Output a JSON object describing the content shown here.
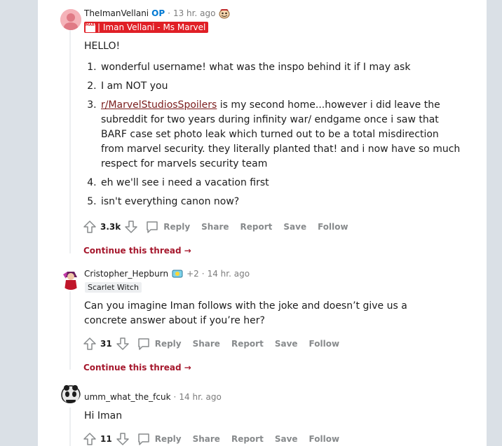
{
  "comments": [
    {
      "author": "TheImanVellani",
      "op_badge": "OP",
      "separator": "·",
      "time": "13 hr. ago",
      "flair": "| Iman Vellani - Ms Marvel",
      "flair_logo_text": "MARVEL STUDIOS",
      "greeting": "HELLO!",
      "list": [
        "wonderful username! what was the inspo behind it if I may ask",
        "I am NOT you",
        "is my second home...however i did leave the subreddit for two years during infinity war/ endgame once i saw that BARF case set photo leak which turned out to be a total misdirection from marvel security. they literally planted that! and i now have so much respect for marvels security team",
        "eh we'll see i need a vacation first",
        "isn't everything canon now?"
      ],
      "list_link": "r/MarvelStudiosSpoilers",
      "votes": "3.3k",
      "actions": {
        "reply": "Reply",
        "share": "Share",
        "report": "Report",
        "save": "Save",
        "follow": "Follow"
      },
      "continue": "Continue this thread →"
    },
    {
      "author": "Cristopher_Hepburn",
      "award_count": "+2",
      "separator": "·",
      "time": "14 hr. ago",
      "flair": "Scarlet Witch",
      "text": "Can you imagine Iman follows with the joke and doesn’t give us a concrete answer about if you’re her?",
      "votes": "31",
      "actions": {
        "reply": "Reply",
        "share": "Share",
        "report": "Report",
        "save": "Save",
        "follow": "Follow"
      },
      "continue": "Continue this thread →"
    },
    {
      "author": "umm_what_the_fcuk",
      "separator": "·",
      "time": "14 hr. ago",
      "text": "Hi Iman",
      "votes": "11",
      "actions": {
        "reply": "Reply",
        "share": "Share",
        "report": "Report",
        "save": "Save",
        "follow": "Follow"
      }
    }
  ],
  "colors": {
    "background": "#dae0e6",
    "panel": "#ffffff",
    "op_blue": "#0079d3",
    "flair_red": "#e01f26",
    "continue_red": "#a6192e",
    "muted": "#878a8c"
  },
  "icons": [
    "upvote-icon",
    "downvote-icon",
    "comment-icon",
    "award-icon",
    "arrow-right-icon"
  ]
}
